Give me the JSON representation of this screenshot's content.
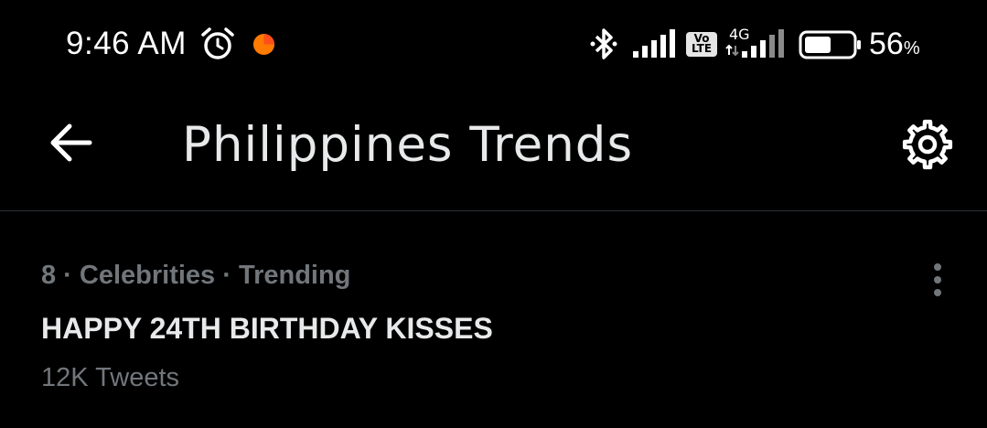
{
  "status_bar": {
    "time": "9:46 AM",
    "icons": [
      "alarm-icon",
      "notification-dot-icon",
      "bluetooth-icon",
      "signal-icon",
      "volte-icon",
      "signal-icon-2",
      "battery-icon"
    ],
    "volte_line1": "Vo",
    "volte_line2": "LTE",
    "network_type": "4G",
    "battery_value": "56",
    "battery_unit": "%",
    "battery_level": 0.56,
    "notification_dot_color": "#ff7a00"
  },
  "header": {
    "title": "Philippines Trends",
    "back_icon": "arrow-left-icon",
    "settings_icon": "gear-icon"
  },
  "trends": [
    {
      "meta": "8 · Celebrities · Trending",
      "name": "HAPPY 24TH BIRTHDAY KISSES",
      "count": "12K Tweets",
      "more_icon": "more-vertical-icon"
    }
  ],
  "colors": {
    "background": "#000000",
    "primary_text": "#e7e9ea",
    "secondary_text": "#71767b",
    "divider": "#2f3336"
  }
}
